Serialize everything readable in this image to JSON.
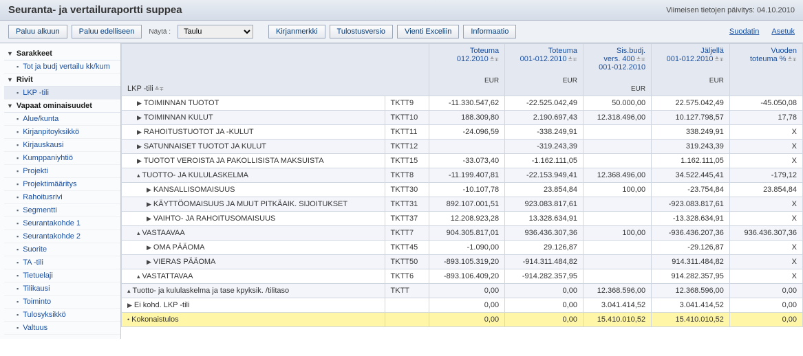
{
  "header": {
    "title": "Seuranta- ja vertailuraportti suppea",
    "updated_label": "Viimeisen tietojen päivitys: 04.10.2010"
  },
  "toolbar": {
    "back_start": "Paluu alkuun",
    "back_prev": "Paluu edelliseen",
    "view_label": "Näytä :",
    "view_select": "Taulu",
    "bookmark": "Kirjanmerkki",
    "print": "Tulostusversio",
    "excel": "Vienti Exceliin",
    "info": "Informaatio",
    "filter": "Suodatin",
    "settings": "Asetuk"
  },
  "sidebar": {
    "section_columns": "Sarakkeet",
    "item_tot": "Tot ja budj vertailu kk/kum",
    "section_rows": "Rivit",
    "item_lkp": "LKP -tili",
    "section_free": "Vapaat ominaisuudet",
    "item_alue": "Alue/kunta",
    "item_kpy": "Kirjanpitoyksikkö",
    "item_kirj": "Kirjauskausi",
    "item_kump": "Kumppaniyhtiö",
    "item_proj": "Projekti",
    "item_projm": "Projektimääritys",
    "item_raho": "Rahoitusrivi",
    "item_segm": "Segmentti",
    "item_sk1": "Seurantakohde 1",
    "item_sk2": "Seurantakohde 2",
    "item_suor": "Suorite",
    "item_ta": "TA -tili",
    "item_tiet": "Tietuelaji",
    "item_tili": "Tilikausi",
    "item_toim": "Toiminto",
    "item_tulo": "Tulosyksikkö",
    "item_valt": "Valtuus"
  },
  "table": {
    "row_header": "LKP -tili",
    "col1_l1": "Toteuma",
    "col1_l2": "012.2010",
    "col2_l1": "Toteuma",
    "col2_l2": "001-012.2010",
    "col3_l1": "Sis.budj.",
    "col3_l2": "vers. 400",
    "col3_l3": "001-012.2010",
    "col4_l1": "Jäljellä",
    "col4_l2": "001-012.2010",
    "col5_l1": "Vuoden",
    "col5_l2": "toteuma %",
    "eur": "EUR",
    "rows": [
      {
        "indent": 1,
        "icon": "▶",
        "label": "TOIMINNAN TUOTOT",
        "code": "TKTT9",
        "c1": "-11.330.547,62",
        "c2": "-22.525.042,49",
        "c3": "50.000,00",
        "c4": "22.575.042,49",
        "c5": "-45.050,08",
        "alt": false
      },
      {
        "indent": 1,
        "icon": "▶",
        "label": "TOIMINNAN KULUT",
        "code": "TKTT10",
        "c1": "188.309,80",
        "c2": "2.190.697,43",
        "c3": "12.318.496,00",
        "c4": "10.127.798,57",
        "c5": "17,78",
        "alt": true
      },
      {
        "indent": 1,
        "icon": "▶",
        "label": "RAHOITUSTUOTOT JA -KULUT",
        "code": "TKTT11",
        "c1": "-24.096,59",
        "c2": "-338.249,91",
        "c3": "",
        "c4": "338.249,91",
        "c5": "X",
        "alt": false
      },
      {
        "indent": 1,
        "icon": "▶",
        "label": "SATUNNAISET TUOTOT JA KULUT",
        "code": "TKTT12",
        "c1": "",
        "c2": "-319.243,39",
        "c3": "",
        "c4": "319.243,39",
        "c5": "X",
        "alt": true
      },
      {
        "indent": 1,
        "icon": "▶",
        "label": "TUOTOT VEROISTA JA PAKOLLISISTA MAKSUISTA",
        "code": "TKTT15",
        "c1": "-33.073,40",
        "c2": "-1.162.111,05",
        "c3": "",
        "c4": "1.162.111,05",
        "c5": "X",
        "alt": false
      },
      {
        "indent": 1,
        "icon": "▴",
        "label": "TUOTTO- JA KULULASKELMA",
        "code": "TKTT8",
        "c1": "-11.199.407,81",
        "c2": "-22.153.949,41",
        "c3": "12.368.496,00",
        "c4": "34.522.445,41",
        "c5": "-179,12",
        "alt": true
      },
      {
        "indent": 2,
        "icon": "▶",
        "label": "KANSALLISOMAISUUS",
        "code": "TKTT30",
        "c1": "-10.107,78",
        "c2": "23.854,84",
        "c3": "100,00",
        "c4": "-23.754,84",
        "c5": "23.854,84",
        "alt": false
      },
      {
        "indent": 2,
        "icon": "▶",
        "label": "KÄYTTÖOMAISUUS JA MUUT PITKÄAIK. SIJOITUKSET",
        "code": "TKTT31",
        "c1": "892.107.001,51",
        "c2": "923.083.817,61",
        "c3": "",
        "c4": "-923.083.817,61",
        "c5": "X",
        "alt": true
      },
      {
        "indent": 2,
        "icon": "▶",
        "label": "VAIHTO- JA RAHOITUSOMAISUUS",
        "code": "TKTT37",
        "c1": "12.208.923,28",
        "c2": "13.328.634,91",
        "c3": "",
        "c4": "-13.328.634,91",
        "c5": "X",
        "alt": false
      },
      {
        "indent": 1,
        "icon": "▴",
        "label": "VASTAAVAA",
        "code": "TKTT7",
        "c1": "904.305.817,01",
        "c2": "936.436.307,36",
        "c3": "100,00",
        "c4": "-936.436.207,36",
        "c5": "936.436.307,36",
        "alt": true
      },
      {
        "indent": 2,
        "icon": "▶",
        "label": "OMA PÄÄOMA",
        "code": "TKTT45",
        "c1": "-1.090,00",
        "c2": "29.126,87",
        "c3": "",
        "c4": "-29.126,87",
        "c5": "X",
        "alt": false
      },
      {
        "indent": 2,
        "icon": "▶",
        "label": "VIERAS PÄÄOMA",
        "code": "TKTT50",
        "c1": "-893.105.319,20",
        "c2": "-914.311.484,82",
        "c3": "",
        "c4": "914.311.484,82",
        "c5": "X",
        "alt": true
      },
      {
        "indent": 1,
        "icon": "▴",
        "label": "VASTATTAVAA",
        "code": "TKTT6",
        "c1": "-893.106.409,20",
        "c2": "-914.282.357,95",
        "c3": "",
        "c4": "914.282.357,95",
        "c5": "X",
        "alt": false
      },
      {
        "indent": 0,
        "icon": "▴",
        "label": "Tuotto- ja kululaskelma ja tase kpyksik. /tilitaso",
        "code": "TKTT",
        "c1": "0,00",
        "c2": "0,00",
        "c3": "12.368.596,00",
        "c4": "12.368.596,00",
        "c5": "0,00",
        "alt": true
      },
      {
        "indent": 0,
        "icon": "▶",
        "label": "Ei kohd. LKP -tili",
        "code": "",
        "c1": "0,00",
        "c2": "0,00",
        "c3": "3.041.414,52",
        "c4": "3.041.414,52",
        "c5": "0,00",
        "alt": false
      },
      {
        "indent": 0,
        "icon": "•",
        "label": "Kokonaistulos",
        "code": "",
        "c1": "0,00",
        "c2": "0,00",
        "c3": "15.410.010,52",
        "c4": "15.410.010,52",
        "c5": "0,00",
        "alt": false,
        "hl": true
      }
    ]
  }
}
